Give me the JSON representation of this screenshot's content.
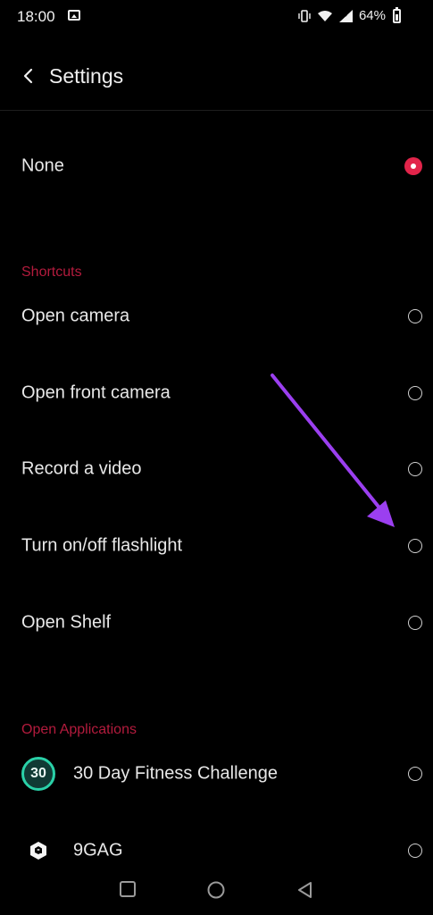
{
  "status_bar": {
    "time": "18:00",
    "battery_percent": "64%",
    "icons": [
      "gallery-notification-icon",
      "vibrate-icon",
      "wifi-icon",
      "signal-icon",
      "battery-icon"
    ]
  },
  "header": {
    "back_icon": "back-arrow-icon",
    "title": "Settings"
  },
  "options": {
    "none": {
      "label": "None",
      "selected": true
    }
  },
  "shortcuts": {
    "section_title": "Shortcuts",
    "items": [
      {
        "label": "Open camera",
        "selected": false
      },
      {
        "label": "Open front camera",
        "selected": false
      },
      {
        "label": "Record a video",
        "selected": false
      },
      {
        "label": "Turn on/off flashlight",
        "selected": false
      },
      {
        "label": "Open Shelf",
        "selected": false
      }
    ]
  },
  "applications": {
    "section_title": "Open Applications",
    "items": [
      {
        "label": "30 Day Fitness Challenge",
        "icon_text": "30",
        "icon": "fitness-app-icon",
        "selected": false
      },
      {
        "label": "9GAG",
        "icon": "9gag-app-icon",
        "selected": false
      }
    ]
  },
  "annotation": {
    "icon": "purple-arrow-annotation",
    "color": "#9b3ff0"
  },
  "nav_bar": {
    "icons": [
      "recents-square-icon",
      "home-circle-icon",
      "back-triangle-icon"
    ]
  },
  "colors": {
    "accent": "#e2244a",
    "section": "#b31b3d",
    "background": "#000000"
  }
}
